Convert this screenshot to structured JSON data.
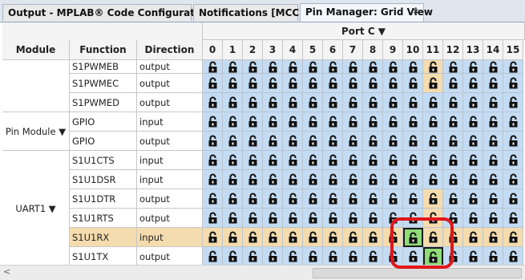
{
  "tabs": [
    {
      "label": "Output - MPLAB® Code Configurator",
      "active": false
    },
    {
      "label": "Notifications [MCC]",
      "active": false
    },
    {
      "label": "Pin Manager: Grid View",
      "active": true,
      "close": "×"
    }
  ],
  "grid": {
    "port_header": "Port C ▼",
    "headers": {
      "module": "Module",
      "function": "Function",
      "direction": "Direction"
    },
    "pins": [
      "0",
      "1",
      "2",
      "3",
      "4",
      "5",
      "6",
      "7",
      "8",
      "9",
      "10",
      "11",
      "12",
      "13",
      "14",
      "15"
    ],
    "modules": [
      {
        "label": "",
        "rows": 3
      },
      {
        "label": "Pin Module ▼",
        "rows": 2
      },
      {
        "label": "UART1 ▼",
        "rows": 6
      }
    ],
    "rows": [
      {
        "function": "S1PWMEB",
        "direction": "output",
        "tan": [
          11
        ],
        "selected": []
      },
      {
        "function": "S1PWMEC",
        "direction": "output",
        "tan": [
          11
        ],
        "selected": []
      },
      {
        "function": "S1PWMED",
        "direction": "output",
        "tan": [],
        "selected": []
      },
      {
        "function": "GPIO",
        "direction": "input",
        "tan": [],
        "selected": []
      },
      {
        "function": "GPIO",
        "direction": "output",
        "tan": [],
        "selected": []
      },
      {
        "function": "S1U1CTS",
        "direction": "input",
        "tan": [],
        "selected": []
      },
      {
        "function": "S1U1DSR",
        "direction": "input",
        "tan": [],
        "selected": []
      },
      {
        "function": "S1U1DTR",
        "direction": "output",
        "tan": [
          11
        ],
        "selected": []
      },
      {
        "function": "S1U1RTS",
        "direction": "output",
        "tan": [
          11
        ],
        "selected": []
      },
      {
        "function": "S1U1RX",
        "direction": "input",
        "tan": "all",
        "selected": [
          10
        ]
      },
      {
        "function": "S1U1TX",
        "direction": "output",
        "tan": [],
        "selected": [
          11
        ]
      }
    ]
  },
  "colors": {
    "blue": "#c4dcf3",
    "tan": "#f5dcae",
    "selected": "#8fdc79",
    "lock": "#111111",
    "highlight": "#e0161b"
  }
}
